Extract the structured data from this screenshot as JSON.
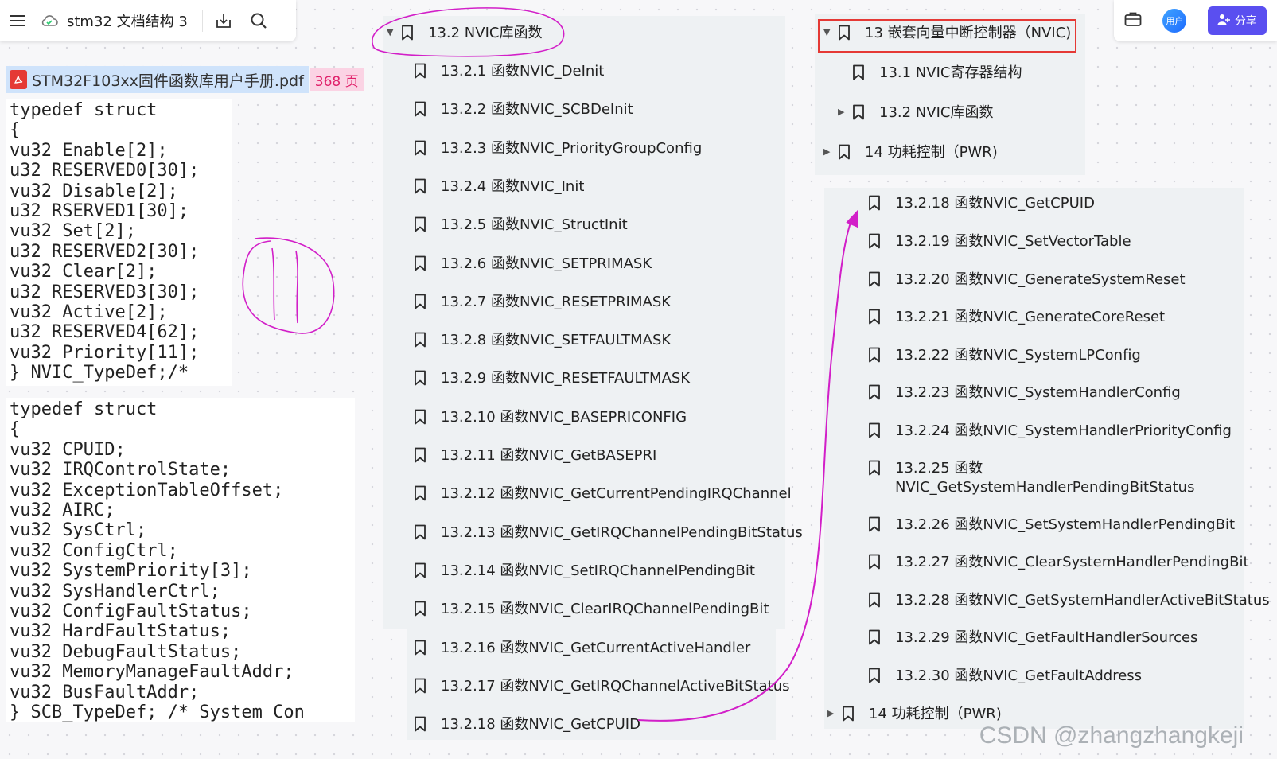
{
  "toolbar": {
    "doc_title": "stm32 文档结构 3",
    "menu_icon": "menu-icon",
    "cloud_icon": "cloud-sync-icon",
    "download_icon": "download-icon",
    "search_icon": "search-icon"
  },
  "right_toolbar": {
    "briefcase_icon": "briefcase-icon",
    "avatar_text": "用户",
    "share_label": "分享"
  },
  "pdf": {
    "name": "STM32F103xx固件函数库用户手册.pdf",
    "page": "368 页"
  },
  "code_blocks": [
    {
      "lines": [
        "typedef struct",
        "{",
        "vu32 Enable[2];",
        "u32 RESERVED0[30];",
        "vu32 Disable[2];",
        "u32 RSERVED1[30];",
        "vu32 Set[2];",
        "u32 RESERVED2[30];",
        "vu32 Clear[2];",
        "u32 RESERVED3[30];",
        "vu32 Active[2];",
        "u32 RESERVED4[62];",
        "vu32 Priority[11];",
        "} NVIC_TypeDef;/*"
      ]
    },
    {
      "lines": [
        "typedef struct",
        "{",
        "vu32 CPUID;",
        "vu32 IRQControlState;",
        "vu32 ExceptionTableOffset;",
        "vu32 AIRC;",
        "vu32 SysCtrl;",
        "vu32 ConfigCtrl;",
        "vu32 SystemPriority[3];",
        "vu32 SysHandlerCtrl;",
        "vu32 ConfigFaultStatus;",
        "vu32 HardFaultStatus;",
        "vu32 DebugFaultStatus;",
        "vu32 MemoryManageFaultAddr;",
        "vu32 BusFaultAddr;",
        "} SCB_TypeDef; /* System Con"
      ]
    }
  ],
  "middle_list": {
    "header": "13.2 NVIC库函数",
    "items": [
      "13.2.1 函数NVIC_DeInit",
      "13.2.2 函数NVIC_SCBDeInit",
      "13.2.3 函数NVIC_PriorityGroupConfig",
      "13.2.4 函数NVIC_Init",
      "13.2.5 函数NVIC_StructInit",
      "13.2.6 函数NVIC_SETPRIMASK",
      "13.2.7 函数NVIC_RESETPRIMASK",
      "13.2.8 函数NVIC_SETFAULTMASK",
      "13.2.9 函数NVIC_RESETFAULTMASK",
      "13.2.10 函数NVIC_BASEPRICONFIG",
      "13.2.11 函数NVIC_GetBASEPRI",
      "13.2.12 函数NVIC_GetCurrentPendingIRQChannel",
      "13.2.13 函数NVIC_GetIRQChannelPendingBitStatus",
      "13.2.14 函数NVIC_SetIRQChannelPendingBit",
      "13.2.15 函数NVIC_ClearIRQChannelPendingBit",
      "13.2.16 函数NVIC_GetCurrentActiveHandler",
      "13.2.17 函数NVIC_GetIRQChannelActiveBitStatus",
      "13.2.18 函数NVIC_GetCPUID"
    ]
  },
  "top_right_list": {
    "items": [
      "13 嵌套向量中断控制器（NVIC)",
      "13.1 NVIC寄存器结构",
      "13.2 NVIC库函数",
      "14 功耗控制（PWR)"
    ]
  },
  "right_list": {
    "items": [
      "13.2.18 函数NVIC_GetCPUID",
      "13.2.19 函数NVIC_SetVectorTable",
      "13.2.20 函数NVIC_GenerateSystemReset",
      "13.2.21 函数NVIC_GenerateCoreReset",
      "13.2.22 函数NVIC_SystemLPConfig",
      "13.2.23 函数NVIC_SystemHandlerConfig",
      "13.2.24 函数NVIC_SystemHandlerPriorityConfig",
      "13.2.25 函数\nNVIC_GetSystemHandlerPendingBitStatus",
      "13.2.26 函数NVIC_SetSystemHandlerPendingBit",
      "13.2.27 函数NVIC_ClearSystemHandlerPendingBit",
      "13.2.28 函数NVIC_GetSystemHandlerActiveBitStatus",
      "13.2.29 函数NVIC_GetFaultHandlerSources",
      "13.2.30 函数NVIC_GetFaultAddress",
      "14 功耗控制（PWR)"
    ]
  },
  "watermark": "CSDN @zhangzhangkeji",
  "colors": {
    "annotation": "#d21fc8",
    "highlight_box": "#e53935",
    "panel": "#eef1f3",
    "share": "#5a4ff0"
  }
}
